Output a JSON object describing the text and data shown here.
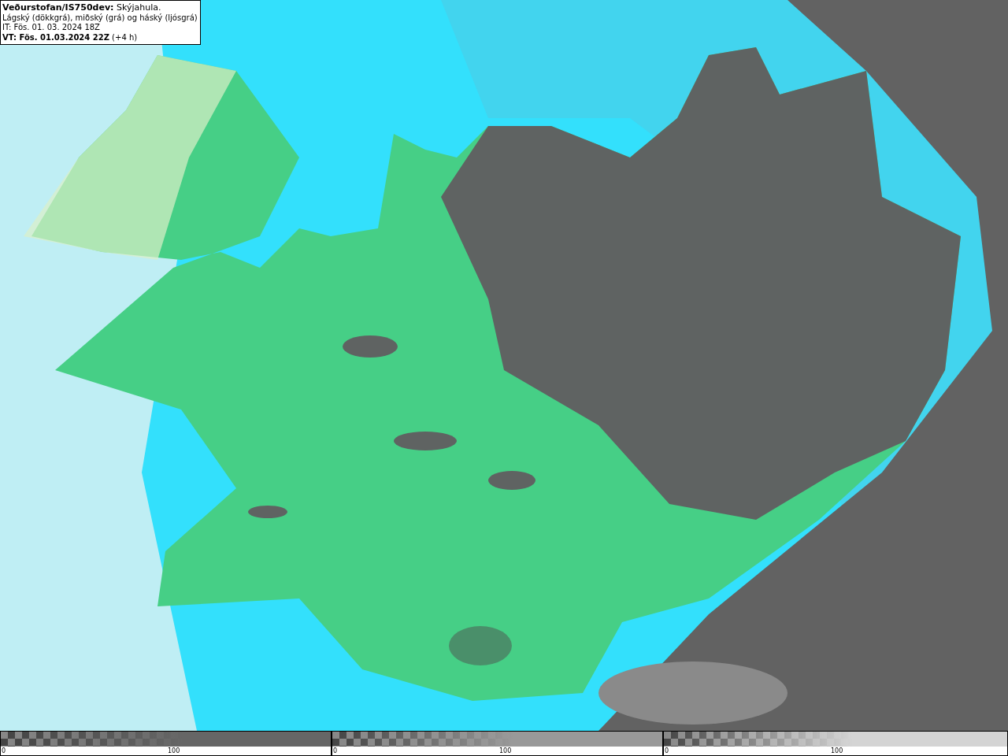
{
  "legend": {
    "lines": [
      "**Veðurstofan/IS750dev:** Skýjahula.",
      "Lágský (dökkgrá), miðský (grá) og háský (ljósgrá)",
      "IT: Fös. 01. 03. 2024 18Z",
      "**VT: Fös. 01.03.2024 22Z** (+4 h)"
    ]
  },
  "scales": [
    {
      "color": "#666666",
      "start_label": "0",
      "mid_label": "100"
    },
    {
      "color": "#999999",
      "start_label": "0",
      "mid_label": "100"
    },
    {
      "color": "#d4d4d4",
      "start_label": "0",
      "mid_label": "100"
    }
  ]
}
